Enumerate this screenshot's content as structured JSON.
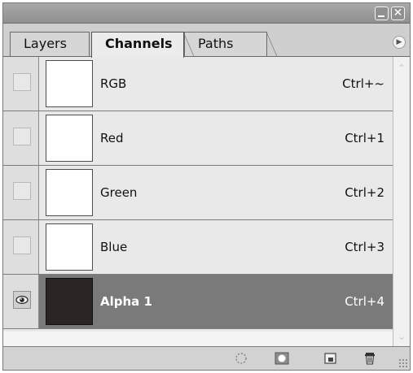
{
  "window": {
    "minimize_icon": "minimize-icon",
    "close_glyph": "✕"
  },
  "tabs": [
    {
      "label": "Layers",
      "active": false
    },
    {
      "label": "Channels",
      "active": true
    },
    {
      "label": "Paths",
      "active": false
    }
  ],
  "channels": [
    {
      "name": "RGB",
      "shortcut": "Ctrl+~",
      "visible": false,
      "selected": false,
      "thumb_color": "#ffffff"
    },
    {
      "name": "Red",
      "shortcut": "Ctrl+1",
      "visible": false,
      "selected": false,
      "thumb_color": "#ffffff"
    },
    {
      "name": "Green",
      "shortcut": "Ctrl+2",
      "visible": false,
      "selected": false,
      "thumb_color": "#ffffff"
    },
    {
      "name": "Blue",
      "shortcut": "Ctrl+3",
      "visible": false,
      "selected": false,
      "thumb_color": "#ffffff"
    },
    {
      "name": "Alpha 1",
      "shortcut": "Ctrl+4",
      "visible": true,
      "selected": true,
      "thumb_color": "#2a2425"
    }
  ],
  "toolbar": {
    "icons": [
      "load-selection-icon",
      "save-selection-as-channel-icon",
      "new-channel-icon",
      "delete-channel-icon"
    ]
  },
  "colors": {
    "selected_row": "#7a7a7a",
    "panel_bg": "#e9e9e9"
  }
}
